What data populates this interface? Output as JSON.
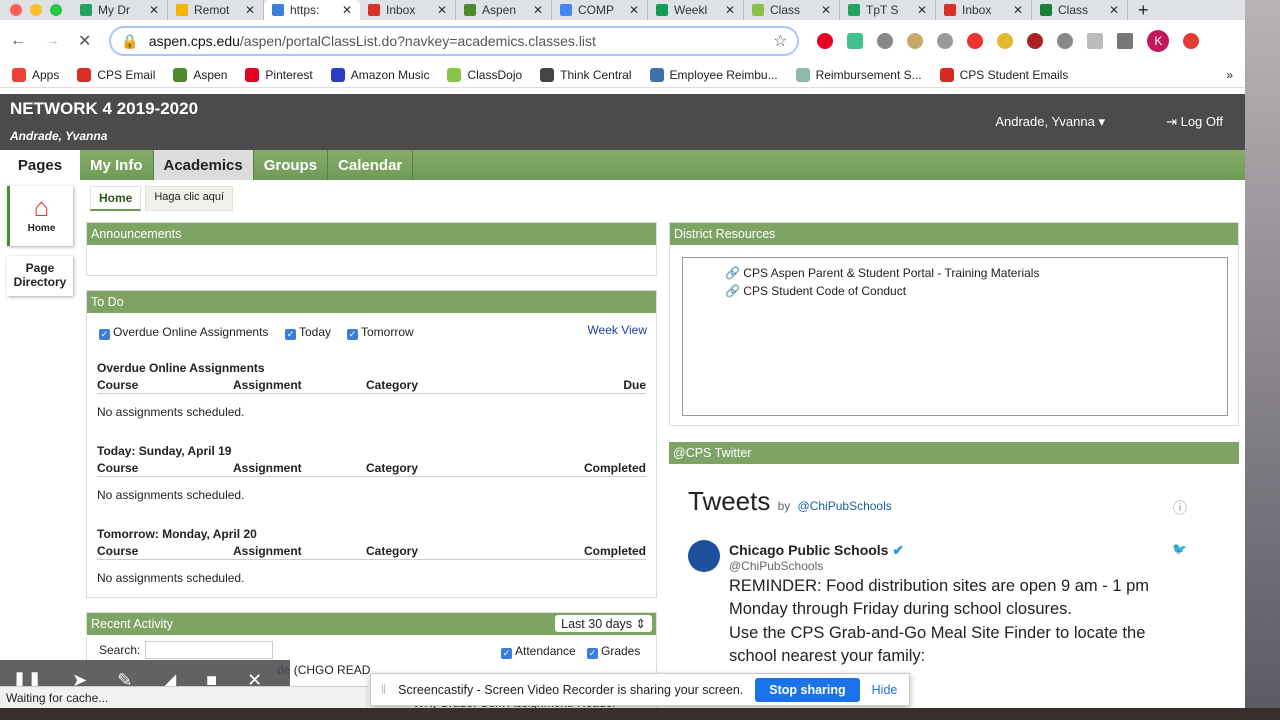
{
  "browser": {
    "tabs": [
      {
        "title": "My Dr",
        "color": "#1fa463"
      },
      {
        "title": "Remot",
        "color": "#f4b400"
      },
      {
        "title": "https:",
        "color": "#3d7fd8",
        "active": true
      },
      {
        "title": "Inbox",
        "color": "#d93025"
      },
      {
        "title": "Aspen",
        "color": "#4b8b2b"
      },
      {
        "title": "COMP",
        "color": "#4285f4"
      },
      {
        "title": "Weekl",
        "color": "#0f9d58"
      },
      {
        "title": "Class",
        "color": "#8bc34a"
      },
      {
        "title": "TpT S",
        "color": "#1fa463"
      },
      {
        "title": "Inbox",
        "color": "#d93025"
      },
      {
        "title": "Class",
        "color": "#188038"
      }
    ],
    "new_tab": "+",
    "url_host": "aspen.cps.edu",
    "url_path": "/aspen/portalClassList.do?navkey=academics.classes.list",
    "profile_initial": "K",
    "bookmarks": [
      {
        "label": "Apps",
        "color": "#ea4335"
      },
      {
        "label": "CPS Email",
        "color": "#d93025"
      },
      {
        "label": "Aspen",
        "color": "#4b8b2b"
      },
      {
        "label": "Pinterest",
        "color": "#e60023"
      },
      {
        "label": "Amazon Music",
        "color": "#2a3cc4"
      },
      {
        "label": "ClassDojo",
        "color": "#8bc34a"
      },
      {
        "label": "Think Central",
        "color": "#444"
      },
      {
        "label": "Employee Reimbu...",
        "color": "#3d6fa8"
      },
      {
        "label": "Reimbursement S...",
        "color": "#8fb8a8"
      },
      {
        "label": "CPS Student Emails",
        "color": "#d52b1e"
      }
    ],
    "bookmarks_more": "»",
    "status": "Waiting for cache..."
  },
  "header": {
    "network": "NETWORK 4 2019-2020",
    "user": "Andrade, Yvanna",
    "account_menu": "Andrade, Yvanna ▾",
    "logoff": "⇥ Log Off"
  },
  "nav": {
    "pages": "Pages",
    "items": [
      "My Info",
      "Academics",
      "Groups",
      "Calendar"
    ],
    "active": "Academics"
  },
  "side": {
    "home": "Home",
    "page_directory": "Page Directory"
  },
  "subtabs": [
    "Home",
    "Haga clic aquí"
  ],
  "announcements": {
    "title": "Announcements"
  },
  "todo": {
    "title": "To Do",
    "filters": [
      "Overdue Online Assignments",
      "Today",
      "Tomorrow"
    ],
    "week_view": "Week View",
    "sections": [
      {
        "heading": "Overdue Online Assignments",
        "cols": [
          "Course",
          "Assignment",
          "Category",
          "Due"
        ],
        "empty": "No assignments scheduled."
      },
      {
        "heading": "Today: Sunday, April 19",
        "cols": [
          "Course",
          "Assignment",
          "Category",
          "Completed"
        ],
        "empty": "No assignments scheduled."
      },
      {
        "heading": "Tomorrow: Monday, April 20",
        "cols": [
          "Course",
          "Assignment",
          "Category",
          "Completed"
        ],
        "empty": "No assignments scheduled."
      }
    ]
  },
  "recent": {
    "title": "Recent Activity",
    "range": "Last 30 days",
    "search_label": "Search:",
    "filters": [
      "Attendance",
      "Grades"
    ],
    "row1_link": "de",
    "row1_text": "(CHGO READ",
    "row2_text": "WK) Grade: Com Assignment: Reader"
  },
  "district": {
    "title": "District Resources",
    "links": [
      "CPS Aspen Parent & Student Portal - Training Materials",
      "CPS Student Code of Conduct"
    ]
  },
  "twitter": {
    "title": "@CPS Twitter",
    "tweets": "Tweets",
    "by": "by",
    "handle_link": "@ChiPubSchools",
    "author": "Chicago Public Schools",
    "author_handle": "@ChiPubSchools",
    "text1": "REMINDER: Food distribution sites are open 9 am - 1 pm Monday through Friday during school closures.",
    "text2": "Use the CPS Grab-and-Go Meal Site Finder to locate the",
    "text3": "school nearest your family:"
  },
  "screencastify": {
    "message": "Screencastify - Screen Video Recorder is sharing your screen.",
    "stop": "Stop sharing",
    "hide": "Hide"
  }
}
